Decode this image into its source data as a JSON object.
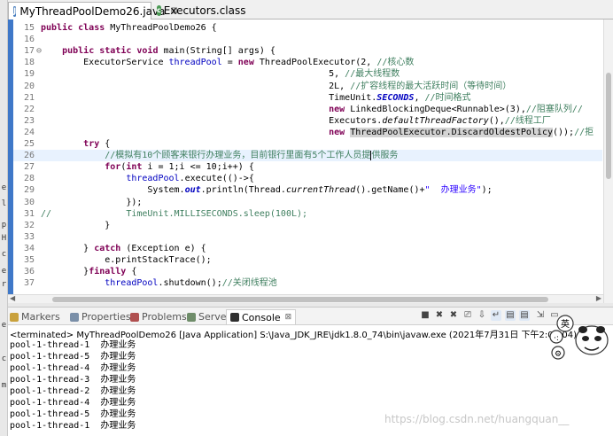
{
  "editor_tabs": [
    {
      "label": "MyThreadPoolDemo26.java",
      "close": "⊠",
      "active": true
    },
    {
      "label": "Executors.class",
      "active": false
    }
  ],
  "left_strip_glyphs": [
    "e",
    "l",
    "p",
    "H",
    "c",
    "e",
    "r",
    "e",
    "c",
    "m"
  ],
  "code_lines": [
    {
      "n": "15",
      "html": "<span class=\"kw\">public class</span> MyThreadPoolDemo26 {"
    },
    {
      "n": "16",
      "html": ""
    },
    {
      "n": "17",
      "marker": "⊖",
      "html": "    <span class=\"kw\">public static void</span> main(String[] args) {"
    },
    {
      "n": "18",
      "html": "        ExecutorService <span class=\"fld\">threadPool</span> = <span class=\"kw\">new</span> ThreadPoolExecutor(2, <span class=\"cm\">//核心数</span>"
    },
    {
      "n": "19",
      "html": "                                                      5, <span class=\"cm\">//最大线程数</span>"
    },
    {
      "n": "20",
      "html": "                                                      2L, <span class=\"cm\">//扩容线程的最大活跃时间（等待时间）</span>"
    },
    {
      "n": "21",
      "html": "                                                      TimeUnit.<span class=\"sfi\">SECONDS</span>, <span class=\"cm\">//时间格式</span>"
    },
    {
      "n": "22",
      "html": "                                                      <span class=\"kw\">new</span> LinkedBlockingDeque&lt;Runnable&gt;(3),<span class=\"cm\">//阻塞队列//</span>"
    },
    {
      "n": "23",
      "html": "                                                      Executors.<span class=\"ital\">defaultThreadFactory</span>(),<span class=\"cm\">//线程工厂</span>"
    },
    {
      "n": "24",
      "html": "                                                      <span class=\"kw\">new</span> <span class=\"hl\">ThreadPoolExecutor.DiscardOldestPolicy</span>());<span class=\"cm\">//拒</span>"
    },
    {
      "n": "25",
      "html": "        <span class=\"kw\">try</span> {"
    },
    {
      "n": "26",
      "current": true,
      "html": "            <span class=\"cm\">//模拟有10个顾客来银行办理业务，目前银行里面有5个工作人员提<span class=\"caret\"></span>供服务</span>"
    },
    {
      "n": "27",
      "html": "            <span class=\"kw\">for</span>(<span class=\"kw\">int</span> i = 1;i &lt;= 10;i++) {"
    },
    {
      "n": "28",
      "html": "                <span class=\"fld\">threadPool</span>.execute(()-&gt;{"
    },
    {
      "n": "29",
      "html": "                    System.<span class=\"sfi\">out</span>.println(Thread.<span class=\"ital\">currentThread</span>().getName()+<span class=\"str\">\"  办理业务\"</span>);"
    },
    {
      "n": "30",
      "html": "                });"
    },
    {
      "n": "31",
      "html": "<span class=\"cm\">//              TimeUnit.MILLISECONDS.sleep(100L);</span>"
    },
    {
      "n": "32",
      "html": "            }"
    },
    {
      "n": "33",
      "html": ""
    },
    {
      "n": "34",
      "html": "        } <span class=\"kw\">catch</span> (Exception e) {"
    },
    {
      "n": "35",
      "html": "            e.printStackTrace();"
    },
    {
      "n": "36",
      "html": "        }<span class=\"kw\">finally</span> {"
    },
    {
      "n": "37",
      "html": "            <span class=\"fld\">threadPool</span>.shutdown();<span class=\"cm\">//关闭线程池</span>"
    }
  ],
  "views": {
    "tabs": [
      "Markers",
      "Properties",
      "Problems",
      "Servers",
      "Console"
    ],
    "console_close": "⊠",
    "active": "Console"
  },
  "console": {
    "terminated": "<terminated> MyThreadPoolDemo26 [Java Application] S:\\Java_JDK_JRE\\jdk1.8.0_74\\bin\\javaw.exe (2021年7月31日 下午2:04:04)",
    "lines": [
      "pool-1-thread-1  办理业务",
      "pool-1-thread-5  办理业务",
      "pool-1-thread-4  办理业务",
      "pool-1-thread-3  办理业务",
      "pool-1-thread-2  办理业务",
      "pool-1-thread-4  办理业务",
      "pool-1-thread-5  办理业务",
      "pool-1-thread-1  办理业务"
    ]
  },
  "mascot": {
    "badge": "英",
    "marks": [
      "·:",
      "⚙"
    ]
  },
  "watermark": "https://blog.csdn.net/huangquan__",
  "colors": {
    "keyword": "#7f0055",
    "comment": "#3f7f5f",
    "string": "#2a00ff",
    "field": "#0000c0",
    "gutter": "#3f78c8"
  }
}
